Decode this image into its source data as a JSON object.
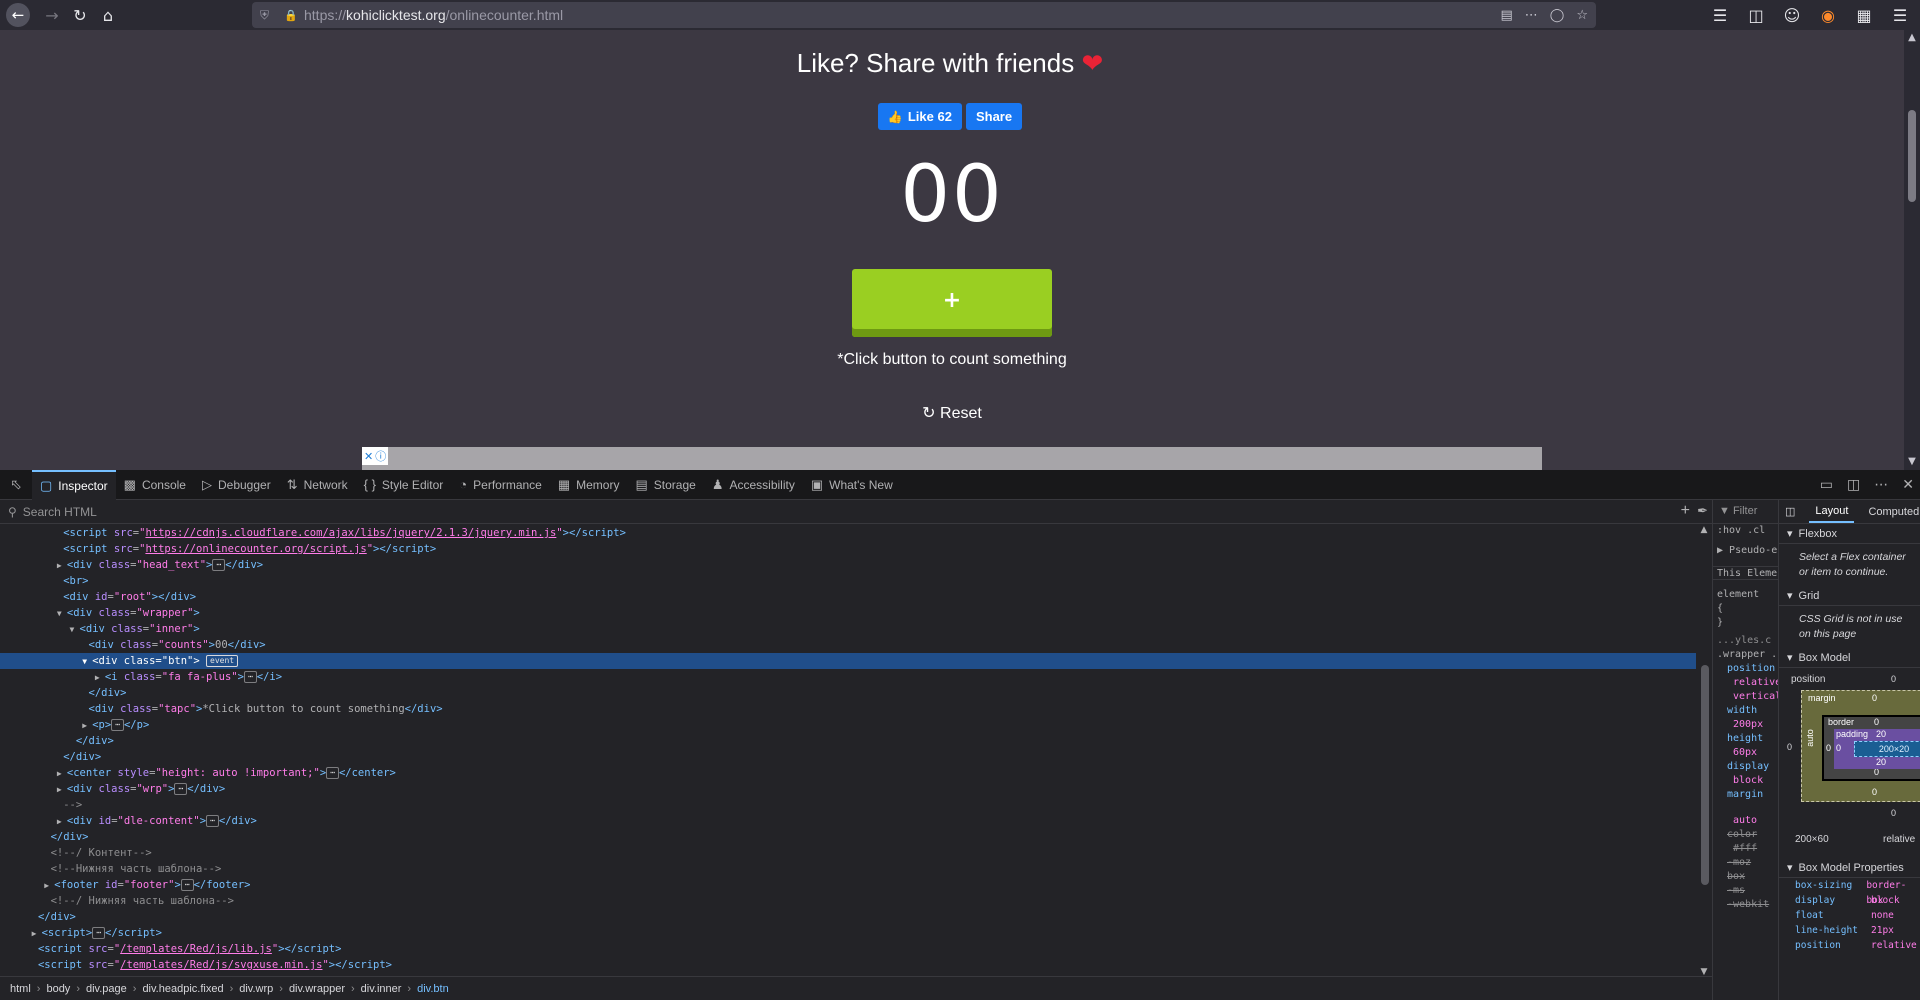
{
  "browser": {
    "url_prefix": "https://",
    "url_host": "kohiclicktest.org",
    "url_path": "/onlinecounter.html"
  },
  "page": {
    "share_title": "Like? Share with friends",
    "like_label": "Like 62",
    "share_label": "Share",
    "count": "00",
    "count_button_label": "+",
    "tapc": "*Click button to count something",
    "reset_label": "Reset"
  },
  "devtools": {
    "tabs": [
      {
        "label": "Inspector",
        "icon": "inspector-icon"
      },
      {
        "label": "Console",
        "icon": "console-icon"
      },
      {
        "label": "Debugger",
        "icon": "debugger-icon"
      },
      {
        "label": "Network",
        "icon": "network-icon"
      },
      {
        "label": "Style Editor",
        "icon": "style-editor-icon"
      },
      {
        "label": "Performance",
        "icon": "performance-icon"
      },
      {
        "label": "Memory",
        "icon": "memory-icon"
      },
      {
        "label": "Storage",
        "icon": "storage-icon"
      },
      {
        "label": "Accessibility",
        "icon": "accessibility-icon"
      },
      {
        "label": "What's New",
        "icon": "whats-new-icon"
      }
    ],
    "search_placeholder": "Search HTML",
    "breadcrumbs": [
      "html",
      "body",
      "div.page",
      "div.headpic.fixed",
      "div.wrp",
      "div.wrapper",
      "div.inner",
      "div.btn"
    ],
    "markup": {
      "l1_src": "https://cdnjs.cloudflare.com/ajax/libs/jquery/2.1.3/jquery.min.js",
      "l2_src": "https://onlinecounter.org/script.js",
      "l3_class": "head_text",
      "l5_id": "root",
      "l6_class": "wrapper",
      "l7_class": "inner",
      "l8_class": "counts",
      "l8_text": "00",
      "l9_class": "btn",
      "l9_badge": "event",
      "l10_class": "fa fa-plus",
      "l12_class": "tapc",
      "l12_text": "*Click button to count something",
      "l16_style": "height: auto !important;",
      "l17_class": "wrp",
      "l19_id": "dle-content",
      "l21_comment": "<!--/ Контент-->",
      "l22_comment": "<!--Нижняя часть шаблона-->",
      "l23_id": "footer",
      "l24_comment": "<!--/ Нижняя часть шаблона-->",
      "l27_src": "/templates/Red/js/lib.js",
      "l28_src": "/templates/Red/js/svgxuse.min.js"
    },
    "rules": {
      "filter": "Filter",
      "hov": ":hov",
      "cls": ".cl",
      "pseudo": "Pseudo-elements",
      "this_element": "This Element",
      "element_rule": "element",
      "brace_open": "{",
      "brace_close": "}",
      "styles_src": "...yles.c",
      "selector": ".wrapper .btn",
      "props": [
        "position",
        "relative",
        "vertical",
        "width",
        "200px",
        "height",
        "60px",
        "display",
        "block",
        "margin",
        "auto",
        "color",
        "#fff",
        "-moz",
        "box",
        "-ms",
        "-webkit"
      ]
    },
    "layout": {
      "tab_layout": "Layout",
      "tab_computed": "Computed",
      "flexbox_title": "Flexbox",
      "flexbox_note": "Select a Flex container or item to continue.",
      "grid_title": "Grid",
      "grid_note": "CSS Grid is not in use on this page",
      "box_model_title": "Box Model",
      "position_label": "position",
      "position_val": "0",
      "margin_label": "margin",
      "margin_top": "0",
      "margin_bottom": "0",
      "margin_left": "auto",
      "border_label": "border",
      "border_top": "0",
      "border_bottom": "0",
      "border_left": "0",
      "padding_label": "padding",
      "padding_top": "20",
      "padding_bottom": "20",
      "padding_left": "0",
      "content_size": "200×20",
      "outer_left": "0",
      "bottom_val": "0",
      "dimensions": "200×60",
      "dimensions_note": "relative",
      "bmp_title": "Box Model Properties",
      "bmp": [
        {
          "k": "box-sizing",
          "v": "border-box"
        },
        {
          "k": "display",
          "v": "block"
        },
        {
          "k": "float",
          "v": "none"
        },
        {
          "k": "line-height",
          "v": "21px"
        },
        {
          "k": "position",
          "v": "relative"
        }
      ]
    }
  }
}
